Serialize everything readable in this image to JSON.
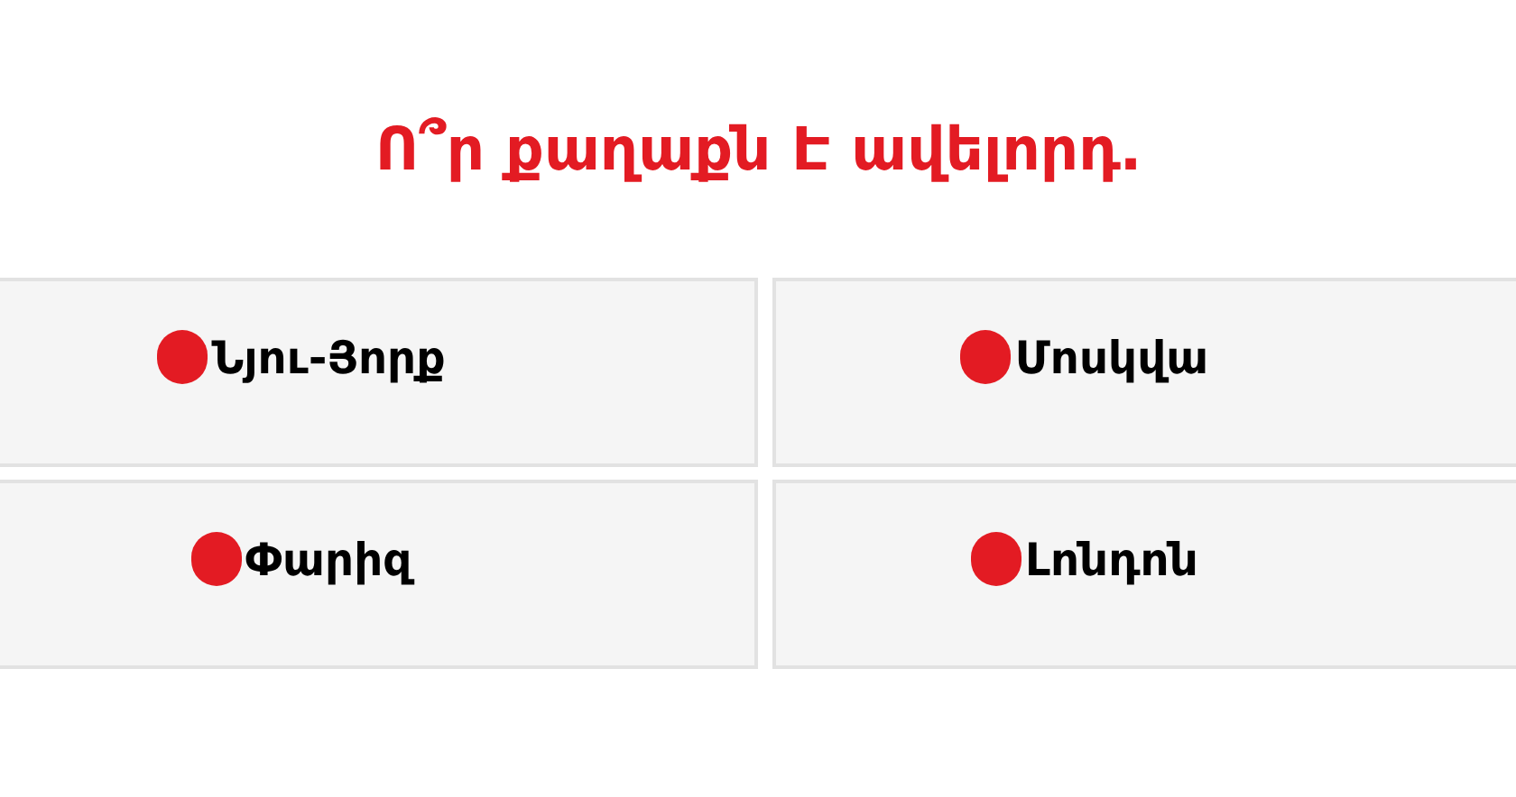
{
  "question": "Ո՞ր քաղաքն Է ավելորդ․",
  "options": [
    {
      "label": "Նյու-Յորք",
      "selected": false
    },
    {
      "label": "Մոսկվա",
      "selected": false
    },
    {
      "label": "Փարիզ",
      "selected": false
    },
    {
      "label": "Լոնդոն",
      "selected": false
    }
  ]
}
